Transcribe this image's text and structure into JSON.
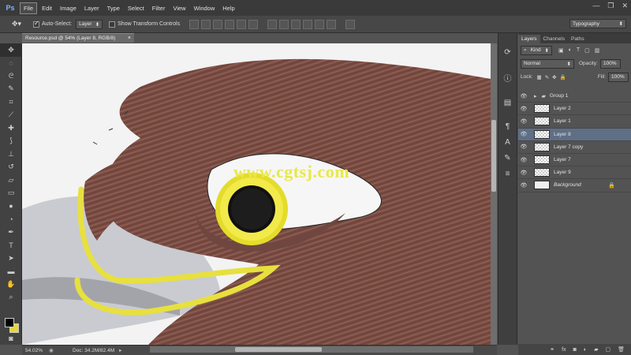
{
  "app": {
    "logo": "Ps"
  },
  "menu": [
    "File",
    "Edit",
    "Image",
    "Layer",
    "Type",
    "Select",
    "Filter",
    "View",
    "Window",
    "Help"
  ],
  "window_controls": {
    "minimize": "—",
    "restore": "❐",
    "close": "✕"
  },
  "options": {
    "auto_select_label": "Auto-Select:",
    "auto_select_checked": true,
    "auto_select_value": "Layer",
    "transform_label": "Show Transform Controls",
    "transform_checked": false,
    "workspace": "Typography"
  },
  "document": {
    "tab_title": "Resource.psd @ 54% (Layer 8, RGB/8)",
    "tab_close": "×",
    "marker": "*",
    "watermark": "www.cgtsj.com"
  },
  "status": {
    "zoom": "54.02%",
    "doc_info": "Doc: 34.2M/82.4M"
  },
  "layers_panel": {
    "tabs": [
      "Layers",
      "Channels",
      "Paths"
    ],
    "active_tab": 0,
    "filter_kind": "Kind",
    "blend_mode": "Normal",
    "opacity_label": "Opacity:",
    "opacity": "100%",
    "lock_label": "Lock:",
    "fill_label": "Fill:",
    "fill": "100%",
    "layers": [
      {
        "name": "Group 1",
        "type": "group",
        "selected": false
      },
      {
        "name": "Layer 2",
        "type": "layer",
        "selected": false
      },
      {
        "name": "Layer 1",
        "type": "layer",
        "selected": false
      },
      {
        "name": "Layer 8",
        "type": "layer",
        "selected": true
      },
      {
        "name": "Layer 7 copy",
        "type": "layer",
        "selected": false
      },
      {
        "name": "Layer 7",
        "type": "layer",
        "selected": false
      },
      {
        "name": "Layer 9",
        "type": "layer",
        "selected": false
      },
      {
        "name": "Background",
        "type": "background",
        "selected": false,
        "locked": true
      }
    ]
  },
  "colors": {
    "foreground": "#000000",
    "background": "#e6d834",
    "selection": "#5e6f86"
  }
}
